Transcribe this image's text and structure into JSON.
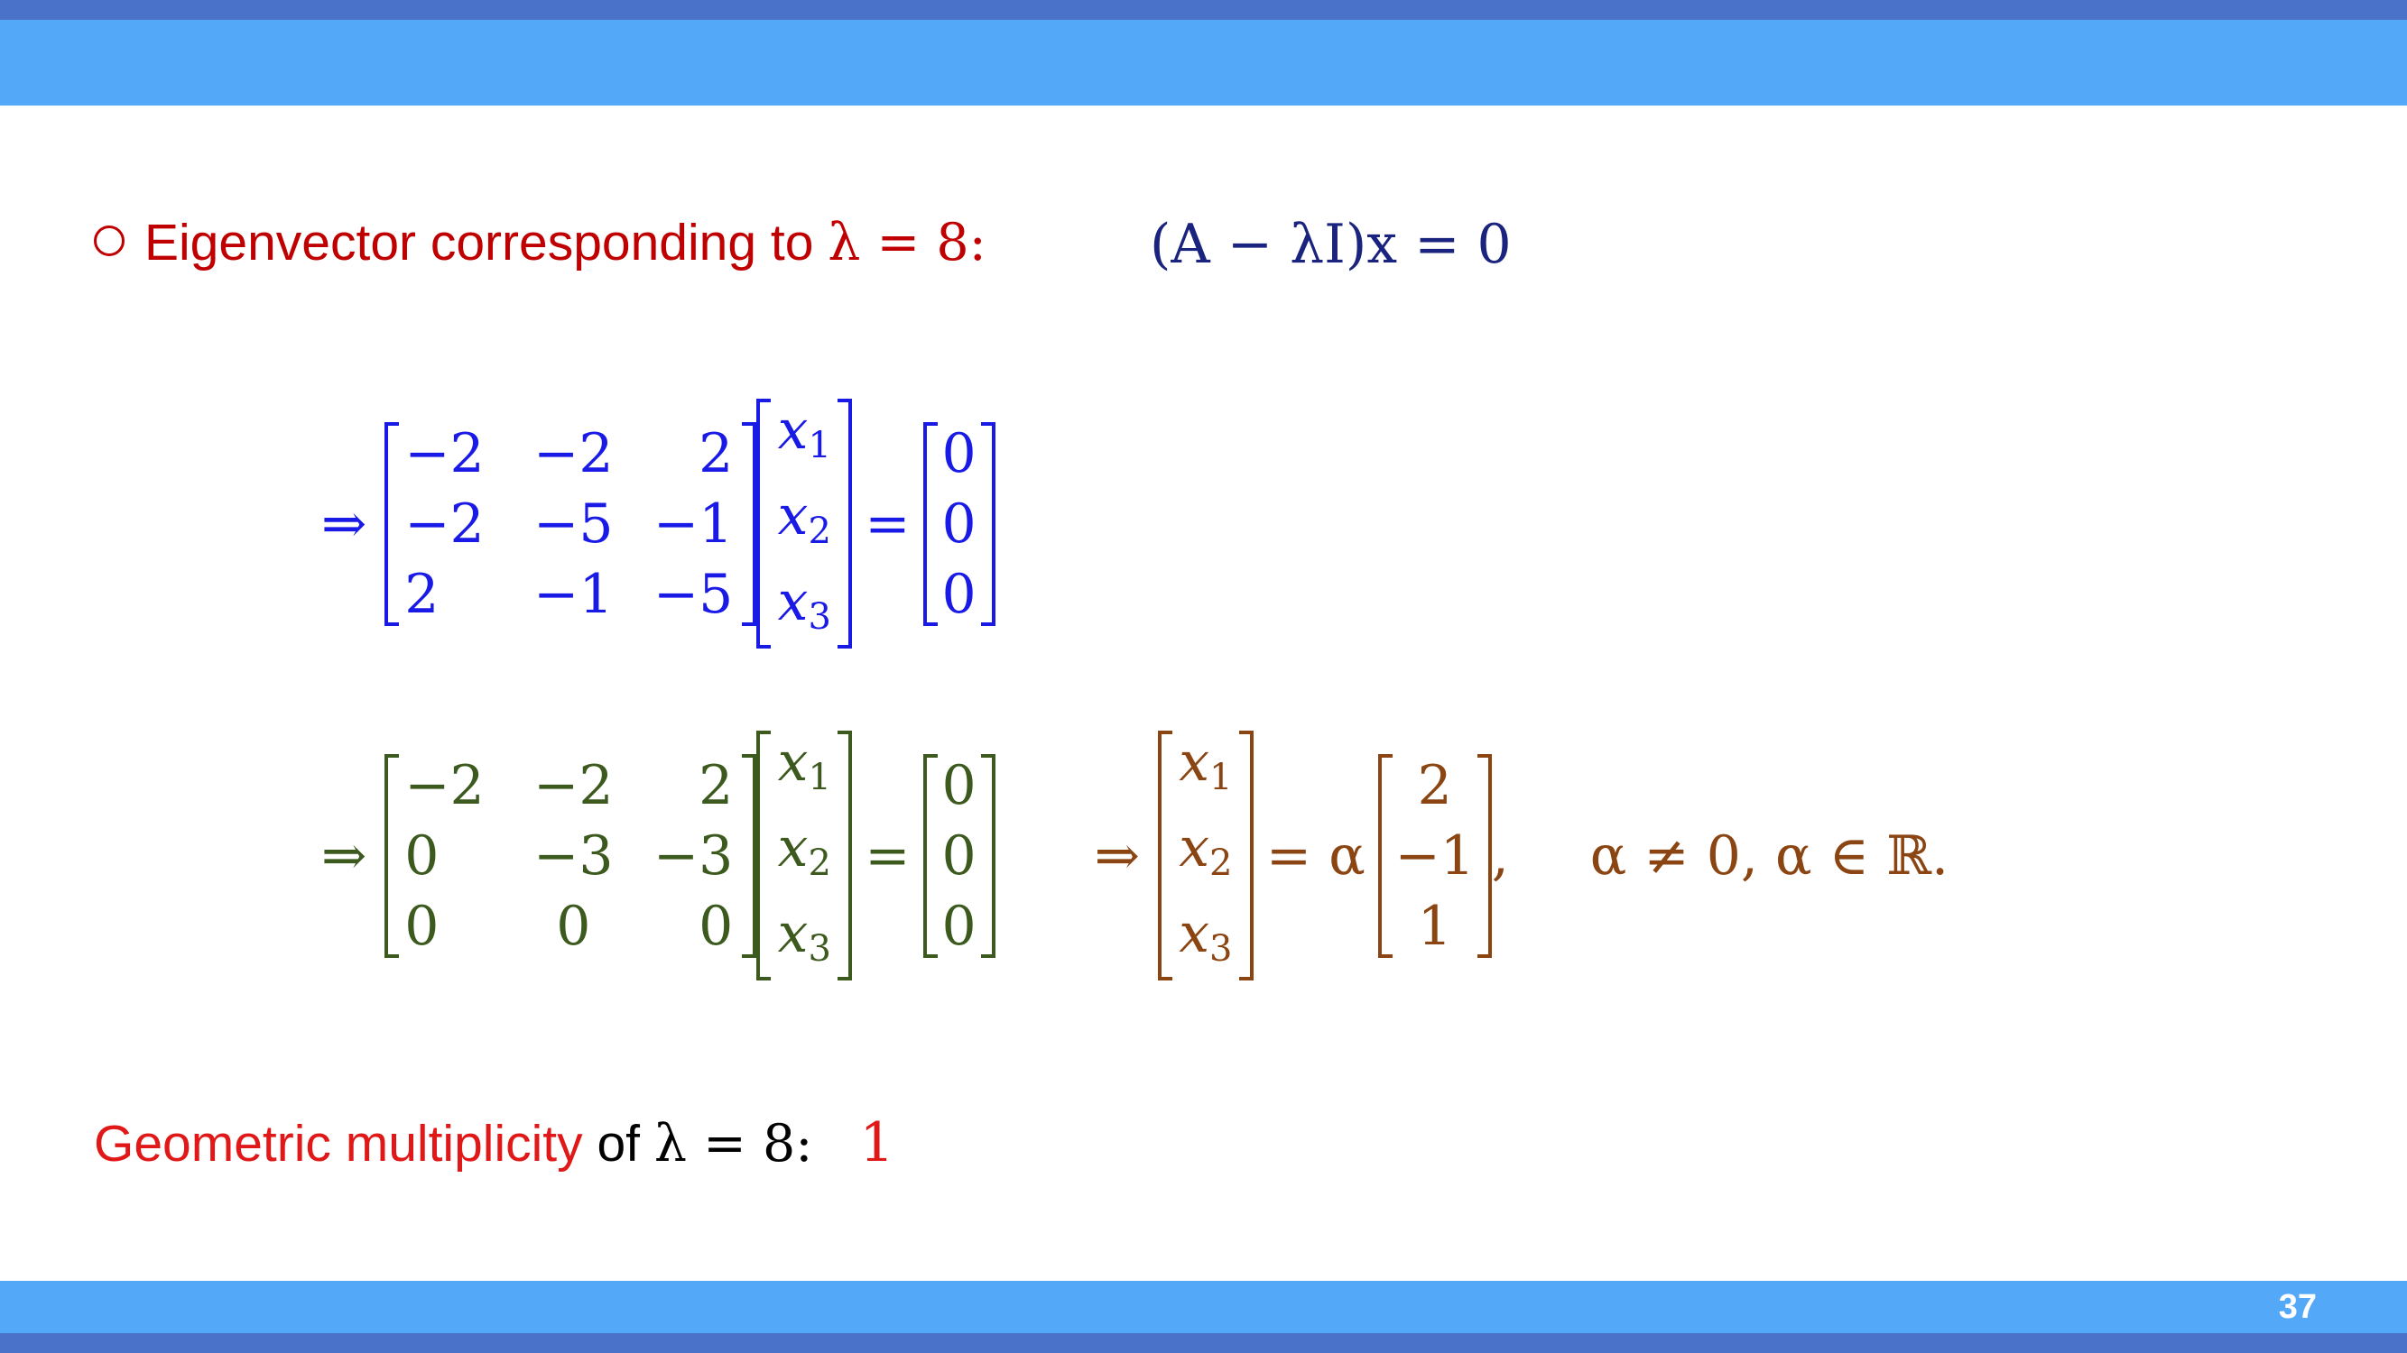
{
  "slide": {
    "page_number": "37"
  },
  "bullet": {
    "text": "Eigenvector corresponding to ",
    "lambda_expr": "λ = 8:",
    "equation": "(A − λI)x = 0"
  },
  "step1": {
    "arrow": "⇒",
    "matrix": [
      [
        "−2",
        "−2",
        "2"
      ],
      [
        "−2",
        "−5",
        "−1"
      ],
      [
        "2",
        "−1",
        "−5"
      ]
    ],
    "vector": [
      "x",
      "x",
      "x"
    ],
    "vector_subs": [
      "1",
      "2",
      "3"
    ],
    "equals": "=",
    "rhs": [
      "0",
      "0",
      "0"
    ]
  },
  "step2": {
    "arrow": "⇒",
    "matrix": [
      [
        "−2",
        "−2",
        "2"
      ],
      [
        "0",
        "−3",
        "−3"
      ],
      [
        "0",
        "0",
        "0"
      ]
    ],
    "vector": [
      "x",
      "x",
      "x"
    ],
    "vector_subs": [
      "1",
      "2",
      "3"
    ],
    "equals": "=",
    "rhs": [
      "0",
      "0",
      "0"
    ],
    "result_arrow": "⇒",
    "result_equals": "= α",
    "result_vector": [
      "2",
      "−1",
      "1"
    ],
    "comma": ",",
    "condition": "α ≠ 0, α ∈ ℝ."
  },
  "geometric": {
    "label": "Geometric multiplicity",
    "of": " of ",
    "lambda_expr": "λ = 8:",
    "value": "1"
  },
  "colors": {
    "bar": "#54a8f8",
    "bar_edge": "#4a72c8",
    "bullet_red": "#c00000",
    "equation_navy": "#1a237e",
    "step1_blue": "#1a1ae6",
    "step2_green": "#3c5a1e",
    "result_brown": "#8b4513",
    "geo_red": "#e01818"
  }
}
